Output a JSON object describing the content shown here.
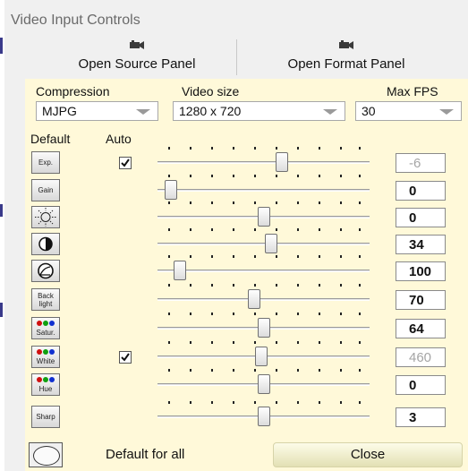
{
  "window": {
    "title": "Video Input Controls"
  },
  "toolbar": {
    "open_source_panel": "Open Source Panel",
    "open_format_panel": "Open Format Panel"
  },
  "format": {
    "compression_label": "Compression",
    "compression_value": "MJPG",
    "video_size_label": "Video size",
    "video_size_value": "1280 x 720",
    "max_fps_label": "Max FPS",
    "max_fps_value": "30"
  },
  "columns": {
    "default_label": "Default",
    "auto_label": "Auto"
  },
  "controls": [
    {
      "name": "exposure",
      "button_label": "Exp.",
      "icon": "",
      "auto": true,
      "value": "-6",
      "dimmed": true,
      "level": 0.6
    },
    {
      "name": "gain",
      "button_label": "Gain",
      "icon": "",
      "auto": false,
      "value": "0",
      "dimmed": false,
      "level": 0.0
    },
    {
      "name": "brightness",
      "button_label": "",
      "icon": "sun-icon",
      "auto": false,
      "value": "0",
      "dimmed": false,
      "level": 0.5
    },
    {
      "name": "contrast",
      "button_label": "",
      "icon": "contrast-icon",
      "auto": false,
      "value": "34",
      "dimmed": false,
      "level": 0.54
    },
    {
      "name": "gamma",
      "button_label": "",
      "icon": "gamma-icon",
      "auto": false,
      "value": "100",
      "dimmed": false,
      "level": 0.05
    },
    {
      "name": "backlight",
      "button_label": "Back light",
      "icon": "",
      "auto": false,
      "value": "70",
      "dimmed": false,
      "level": 0.45
    },
    {
      "name": "saturation",
      "button_label": "Satur.",
      "icon": "rgb-dots-icon",
      "auto": false,
      "value": "64",
      "dimmed": false,
      "level": 0.5
    },
    {
      "name": "white",
      "button_label": "White",
      "icon": "rgb-dots-icon",
      "auto": true,
      "value": "460",
      "dimmed": true,
      "level": 0.49
    },
    {
      "name": "hue",
      "button_label": "Hue",
      "icon": "rgb-dots-icon",
      "auto": false,
      "value": "0",
      "dimmed": false,
      "level": 0.5
    },
    {
      "name": "sharpness",
      "button_label": "Sharp",
      "icon": "",
      "auto": false,
      "value": "3",
      "dimmed": false,
      "level": 0.5
    }
  ],
  "footer": {
    "default_all_label": "Default for all",
    "close_label": "Close"
  },
  "colors": {
    "panel_bg": "#fff9d9",
    "window_bg": "#f0f0f0",
    "close_bg": "#eae7c0"
  }
}
